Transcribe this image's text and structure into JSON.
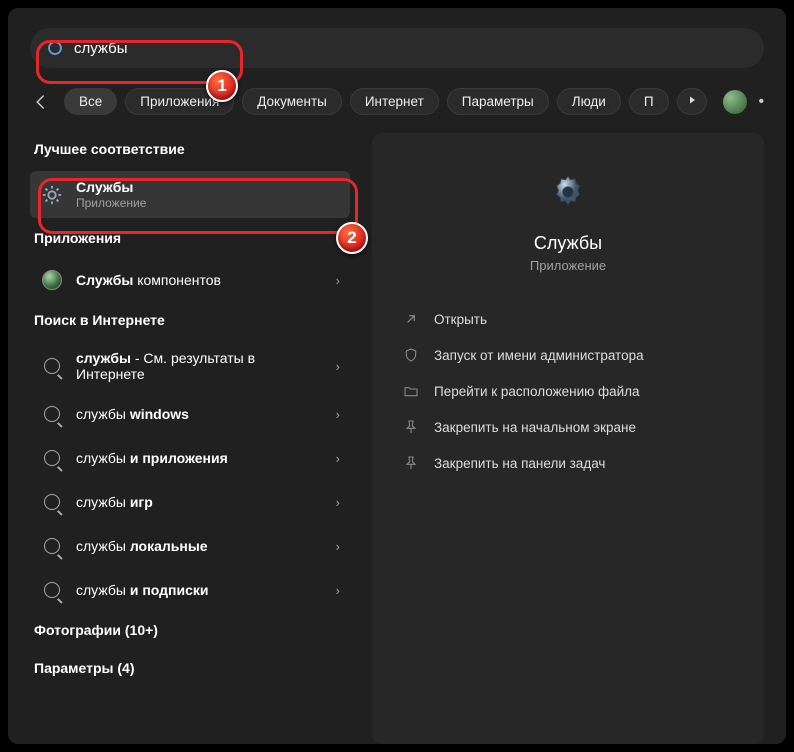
{
  "search": {
    "value": "службы"
  },
  "filters": {
    "items": [
      "Все",
      "Приложения",
      "Документы",
      "Интернет",
      "Параметры",
      "Люди",
      "П"
    ],
    "active_index": 0
  },
  "sections": {
    "best_match": "Лучшее соответствие",
    "apps": "Приложения",
    "web": "Поиск в Интернете",
    "photos": "Фотографии (10+)",
    "settings": "Параметры (4)"
  },
  "best": {
    "title": "Службы",
    "subtitle": "Приложение"
  },
  "app_results": [
    {
      "prefix": "Службы",
      "suffix": " компонентов"
    }
  ],
  "web_results": [
    {
      "prefix": "службы",
      "suffix": " - См. результаты в Интернете",
      "two_line": true
    },
    {
      "prefix": "службы ",
      "suffix": "windows"
    },
    {
      "prefix": "службы ",
      "suffix": "и приложения"
    },
    {
      "prefix": "службы ",
      "suffix": "игр"
    },
    {
      "prefix": "службы ",
      "suffix": "локальные"
    },
    {
      "prefix": "службы ",
      "suffix": "и подписки"
    }
  ],
  "detail": {
    "title": "Службы",
    "subtitle": "Приложение",
    "actions": [
      "Открыть",
      "Запуск от имени администратора",
      "Перейти к расположению файла",
      "Закрепить на начальном экране",
      "Закрепить на панели задач"
    ]
  },
  "annotations": {
    "one": "1",
    "two": "2"
  }
}
